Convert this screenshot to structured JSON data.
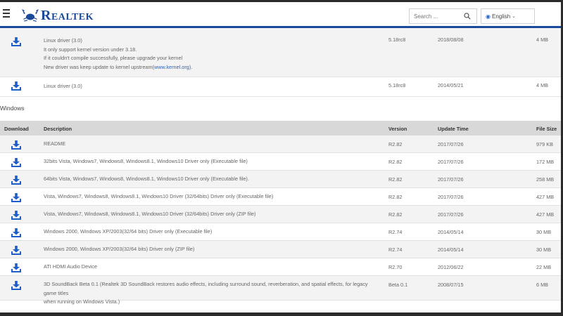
{
  "header": {
    "brand": "Realtek",
    "search_placeholder": "Search ...",
    "language": "English"
  },
  "linux_rows": [
    {
      "lines": [
        "Linux driver (3.0)",
        "It only support kernel version under 3.18.",
        "If it couldn't compile successfully, please upgrade your kernel"
      ],
      "last_line_prefix": "New driver was keep update to kernel upstream(",
      "last_line_link": "www.kernel.org",
      "last_line_suffix": ").",
      "version": "5.18rc8",
      "date": "2018/08/08",
      "size": "4 MB"
    },
    {
      "desc": "Linux driver (3.0)",
      "version": "5.18rc8",
      "date": "2014/05/21",
      "size": "4 MB"
    }
  ],
  "windows": {
    "section_title": "Windows",
    "columns": {
      "download": "Download",
      "description": "Description",
      "version": "Version",
      "update_time": "Update Time",
      "file_size": "File Size"
    },
    "rows": [
      {
        "desc": "README",
        "version": "R2.82",
        "date": "2017/07/26",
        "size": "979 KB"
      },
      {
        "desc": "32bits Vista, Windows7, Windows8, Windows8.1, Windows10 Driver only (Executable file)",
        "version": "R2.82",
        "date": "2017/07/26",
        "size": "172 MB"
      },
      {
        "desc": "64bits Vista, Windows7, Windows8, Windows8.1, Windows10 Driver only (Executable file).",
        "version": "R2.82",
        "date": "2017/07/26",
        "size": "258 MB"
      },
      {
        "desc": "Vista, Windows7, Windows8, Windows8.1, Windows10 Driver (32/64bits) Driver only (Executable file)",
        "version": "R2.82",
        "date": "2017/07/26",
        "size": "427 MB"
      },
      {
        "desc": "Vista, Windows7, Windows8, Windows8.1, Windows10 Driver (32/64bits) Driver only (ZIP file)",
        "version": "R2.82",
        "date": "2017/07/26",
        "size": "427 MB"
      },
      {
        "desc": "Windows 2000, Windows XP/2003(32/64 bits) Driver only (Executable file)",
        "version": "R2.74",
        "date": "2014/05/14",
        "size": "30 MB"
      },
      {
        "desc": "Windows 2000, Windows XP/2003(32/64 bits) Driver only (ZIP file)",
        "version": "R2.74",
        "date": "2014/05/14",
        "size": "30 MB"
      },
      {
        "desc": "ATI HDMI Audio Device",
        "version": "R2.70",
        "date": "2012/06/22",
        "size": "22 MB"
      },
      {
        "desc": "3D SoundBack Beta 0.1 (Realtek 3D SoundBack restores audio effects, including surround sound, reverberation, and spatial effects, for legacy game titles",
        "desc2": "when running on Windows Vista.)",
        "version": "Beta 0.1",
        "date": "2008/07/15",
        "size": "6 MB"
      }
    ]
  },
  "icons": {
    "download": "download-icon",
    "menu": "hamburger-menu-icon",
    "search": "search-icon",
    "globe": "globe-icon",
    "chevron": "chevron-down-icon"
  },
  "colors": {
    "brand_blue": "#1b4a9b",
    "download_icon": "#1f5ec9",
    "link": "#2a63c4",
    "table_header_bg": "#d8d8d8",
    "shaded_row": "#f3f3f3"
  }
}
